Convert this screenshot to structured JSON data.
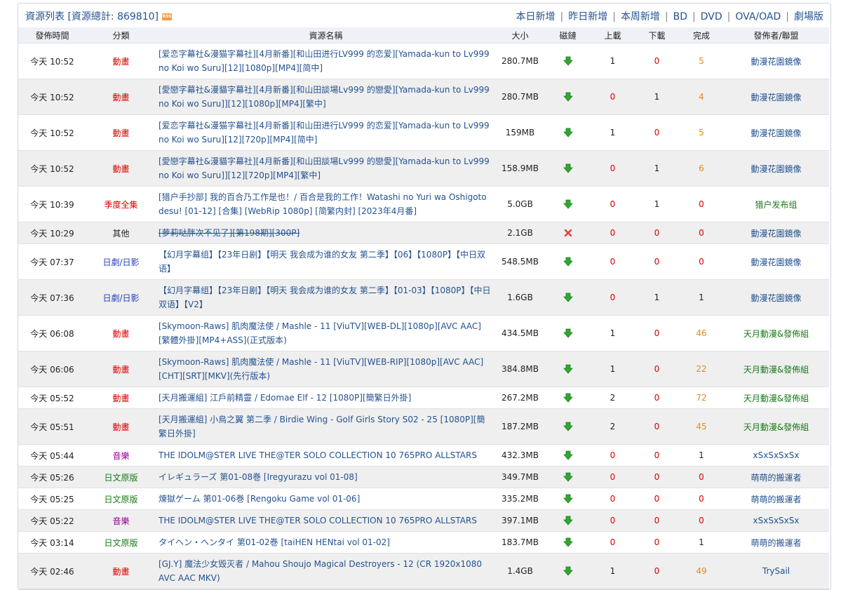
{
  "header": {
    "title": "資源列表 [資源總計: 869810]",
    "rss": "RSS",
    "nav": [
      "本日新增",
      "昨日新增",
      "本周新增",
      "BD",
      "DVD",
      "OVA/OAD",
      "劇場版"
    ]
  },
  "columns": [
    "發佈時間",
    "分類",
    "資源名稱",
    "大小",
    "磁鏈",
    "上載",
    "下載",
    "完成",
    "發佈者/聯盟"
  ],
  "colors": {
    "link": "#245290",
    "anime": "#dd0000",
    "drama": "#2440c0",
    "music": "#990099",
    "comic": "#1a7a1a",
    "season": "#dd0000"
  },
  "rows": [
    {
      "time": "今天 10:52",
      "cat": "動畫",
      "cat_color": "#dd0000",
      "name": "[爱恋字幕社&漫猫字幕社][4月新番][和山田进行LV999 的恋爱][Yamada-kun to Lv999 no Koi wo Suru][12][1080p][MP4][简中]",
      "size": "280.7MB",
      "magnet": "ok",
      "up": "1",
      "down": "0",
      "done": "5",
      "pub": "動漫花園鏡像",
      "pub_color": "#245290",
      "h": 51
    },
    {
      "time": "今天 10:52",
      "cat": "動畫",
      "cat_color": "#dd0000",
      "name": "[愛戀字幕社&漫貓字幕社][4月新番][和山田談場Lv999 的戀愛][Yamada-kun to Lv999 no Koi wo Suru]][12][1080p][MP4][繁中]",
      "size": "280.7MB",
      "magnet": "ok",
      "up": "0",
      "down": "1",
      "done": "4",
      "pub": "動漫花園鏡像",
      "pub_color": "#245290",
      "h": 51
    },
    {
      "time": "今天 10:52",
      "cat": "動畫",
      "cat_color": "#dd0000",
      "name": "[爱恋字幕社&漫猫字幕社][4月新番][和山田进行LV999 的恋爱][Yamada-kun to Lv999 no Koi wo Suru][12][720p][MP4][简中]",
      "size": "159MB",
      "magnet": "ok",
      "up": "1",
      "down": "0",
      "done": "5",
      "pub": "動漫花園鏡像",
      "pub_color": "#245290",
      "h": 51
    },
    {
      "time": "今天 10:52",
      "cat": "動畫",
      "cat_color": "#dd0000",
      "name": "[愛戀字幕社&漫貓字幕社][4月新番][和山田談場Lv999 的戀愛][Yamada-kun to Lv999 no Koi wo Suru]][12][720p][MP4][繁中]",
      "size": "158.9MB",
      "magnet": "ok",
      "up": "0",
      "down": "1",
      "done": "6",
      "pub": "動漫花園鏡像",
      "pub_color": "#245290",
      "h": 51
    },
    {
      "time": "今天 10:39",
      "cat": "季度全集",
      "cat_color": "#dd0000",
      "name": "[猎户手抄部] 我的百合乃工作是也！/ 百合是我的工作！Watashi no Yuri wa Oshigoto desu! [01-12] [合集] [WebRip 1080p] [简繁内封] [2023年4月番]",
      "size": "5.0GB",
      "magnet": "ok",
      "up": "0",
      "down": "1",
      "done": "0",
      "pub": "猎户发布组",
      "pub_color": "#1a7a1a",
      "h": 51
    },
    {
      "time": "今天 10:29",
      "cat": "其他",
      "cat_color": "#222222",
      "name": "[萝莉哒胖次不见了][第198期][300P]",
      "size": "2.1GB",
      "magnet": "bad",
      "up": "0",
      "down": "0",
      "done": "0",
      "pub": "動漫花園鏡像",
      "pub_color": "#245290",
      "h": 31,
      "deleted": true
    },
    {
      "time": "今天 07:37",
      "cat": "日劇/日影",
      "cat_color": "#2440c0",
      "name": "【幻月字幕组】【23年日剧】【明天 我会成为谁的女友 第二季】【06】【1080P】【中日双语】",
      "size": "548.5MB",
      "magnet": "ok",
      "up": "0",
      "down": "0",
      "done": "0",
      "pub": "動漫花園鏡像",
      "pub_color": "#245290",
      "h": 51
    },
    {
      "time": "今天 07:36",
      "cat": "日劇/日影",
      "cat_color": "#2440c0",
      "name": "【幻月字幕组】【23年日剧】【明天 我会成为谁的女友 第二季】【01-03】【1080P】【中日双语】【V2】",
      "size": "1.6GB",
      "magnet": "ok",
      "up": "0",
      "down": "1",
      "done": "1",
      "pub": "動漫花園鏡像",
      "pub_color": "#245290",
      "h": 51
    },
    {
      "time": "今天 06:08",
      "cat": "動畫",
      "cat_color": "#dd0000",
      "name": "[Skymoon-Raws] 肌肉魔法使 / Mashle - 11 [ViuTV][WEB-DL][1080p][AVC AAC][繁體外掛][MP4+ASS](正式版本)",
      "size": "434.5MB",
      "magnet": "ok",
      "up": "1",
      "down": "0",
      "done": "46",
      "pub": "天月動漫&發佈組",
      "pub_color": "#1a7a1a",
      "h": 51
    },
    {
      "time": "今天 06:06",
      "cat": "動畫",
      "cat_color": "#dd0000",
      "name": "[Skymoon-Raws] 肌肉魔法使 / Mashle - 11 [ViuTV][WEB-RIP][1080p][AVC AAC][CHT][SRT][MKV](先行版本)",
      "size": "384.8MB",
      "magnet": "ok",
      "up": "1",
      "down": "0",
      "done": "22",
      "pub": "天月動漫&發佈組",
      "pub_color": "#1a7a1a",
      "h": 51
    },
    {
      "time": "今天 05:52",
      "cat": "動畫",
      "cat_color": "#dd0000",
      "name": "[天月搬運組] 江戶前精靈 / Edomae Elf - 12 [1080P][簡繁日外掛]",
      "size": "267.2MB",
      "magnet": "ok",
      "up": "2",
      "down": "0",
      "done": "72",
      "pub": "天月動漫&發佈組",
      "pub_color": "#1a7a1a",
      "h": 31
    },
    {
      "time": "今天 05:51",
      "cat": "動畫",
      "cat_color": "#dd0000",
      "name": "[天月搬運組] 小鳥之翼 第二季 / Birdie Wing - Golf Girls Story S02 - 25 [1080P][簡繁日外掛]",
      "size": "187.2MB",
      "magnet": "ok",
      "up": "2",
      "down": "0",
      "done": "45",
      "pub": "天月動漫&發佈組",
      "pub_color": "#1a7a1a",
      "h": 51
    },
    {
      "time": "今天 05:44",
      "cat": "音樂",
      "cat_color": "#990099",
      "name": "THE IDOLM@STER LIVE THE@TER SOLO COLLECTION 10 765PRO ALLSTARS",
      "size": "432.3MB",
      "magnet": "ok",
      "up": "0",
      "down": "0",
      "done": "1",
      "pub": "xSxSxSxSx",
      "pub_color": "#245290",
      "h": 31
    },
    {
      "time": "今天 05:26",
      "cat": "日文原版",
      "cat_color": "#1a7a1a",
      "name": "イレギュラーズ 第01-08巻 [Iregyurazu vol 01-08]",
      "size": "349.7MB",
      "magnet": "ok",
      "up": "0",
      "down": "0",
      "done": "0",
      "pub": "萌萌的搬運者",
      "pub_color": "#245290",
      "h": 31
    },
    {
      "time": "今天 05:25",
      "cat": "日文原版",
      "cat_color": "#1a7a1a",
      "name": "煉獄ゲーム 第01-06巻 [Rengoku Game vol 01-06]",
      "size": "335.2MB",
      "magnet": "ok",
      "up": "0",
      "down": "0",
      "done": "0",
      "pub": "萌萌的搬運者",
      "pub_color": "#245290",
      "h": 31
    },
    {
      "time": "今天 05:22",
      "cat": "音樂",
      "cat_color": "#990099",
      "name": "THE IDOLM@STER LIVE THE@TER SOLO COLLECTION 10 765PRO ALLSTARS",
      "size": "397.1MB",
      "magnet": "ok",
      "up": "0",
      "down": "0",
      "done": "0",
      "pub": "xSxSxSxSx",
      "pub_color": "#245290",
      "h": 31
    },
    {
      "time": "今天 03:14",
      "cat": "日文原版",
      "cat_color": "#1a7a1a",
      "name": "タイヘン・ヘンタイ 第01-02巻 [taiHEN HENtai vol 01-02]",
      "size": "183.7MB",
      "magnet": "ok",
      "up": "0",
      "down": "0",
      "done": "1",
      "pub": "萌萌的搬運者",
      "pub_color": "#245290",
      "h": 31
    },
    {
      "time": "今天 02:46",
      "cat": "動畫",
      "cat_color": "#dd0000",
      "name": "[GJ.Y] 魔法少女毁灭者 / Mahou Shoujo Magical Destroyers - 12 (CR 1920x1080 AVC AAC MKV)",
      "size": "1.4GB",
      "magnet": "ok",
      "up": "1",
      "down": "0",
      "done": "49",
      "pub": "TrySail",
      "pub_color": "#245290",
      "h": 51
    }
  ]
}
